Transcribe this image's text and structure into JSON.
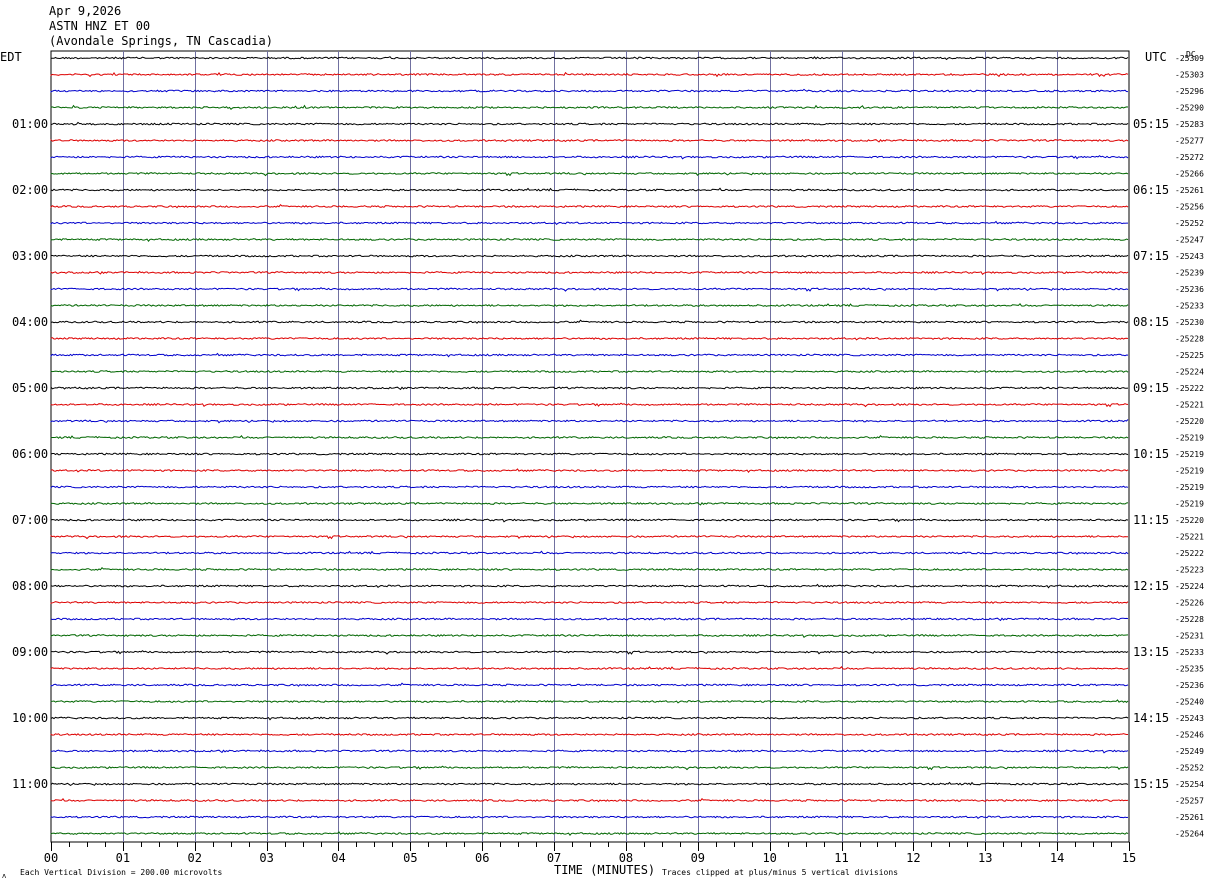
{
  "header": {
    "date": "Apr 9,2026",
    "station": "ASTN HNZ ET 00",
    "location": "(Avondale Springs, TN Cascadia)"
  },
  "labels": {
    "left_tz": "EDT",
    "right_tz": "UTC",
    "dc_label": "DC",
    "xlabel": "TIME (MINUTES)",
    "scale_note": "Each Vertical Division =  200.00 microvolts",
    "clip_note": "Traces clipped at plus/minus 5 vertical divisions",
    "corner_mark": "ʌ"
  },
  "colors": {
    "trace_cycle": [
      "#000000",
      "#dd0000",
      "#0000cc",
      "#006600"
    ],
    "gridline": "#7070a0",
    "text": "#000000"
  },
  "chart_data": {
    "type": "line",
    "description_kind": "helicorder",
    "xlim": [
      0,
      15
    ],
    "x_ticks": [
      "00",
      "01",
      "02",
      "03",
      "04",
      "05",
      "06",
      "07",
      "08",
      "09",
      "10",
      "11",
      "12",
      "13",
      "14",
      "15"
    ],
    "rows": 48,
    "left_time_labels": [
      "01:00",
      "02:00",
      "03:00",
      "04:00",
      "05:00",
      "06:00",
      "07:00",
      "08:00",
      "09:00",
      "10:00",
      "11:00"
    ],
    "right_time_labels": [
      "05:15",
      "06:15",
      "07:15",
      "08:15",
      "09:15",
      "10:15",
      "11:15",
      "12:15",
      "13:15",
      "14:15",
      "15:15"
    ],
    "dc_offsets": [
      "-25309",
      "-25303",
      "-25296",
      "-25290",
      "-25283",
      "-25277",
      "-25272",
      "-25266",
      "-25261",
      "-25256",
      "-25252",
      "-25247",
      "-25243",
      "-25239",
      "-25236",
      "-25233",
      "-25230",
      "-25228",
      "-25225",
      "-25224",
      "-25222",
      "-25221",
      "-25220",
      "-25219",
      "-25219",
      "-25219",
      "-25219",
      "-25219",
      "-25220",
      "-25221",
      "-25222",
      "-25223",
      "-25224",
      "-25226",
      "-25228",
      "-25231",
      "-25233",
      "-25235",
      "-25236",
      "-25240",
      "-25243",
      "-25246",
      "-25249",
      "-25252",
      "-25254",
      "-25257",
      "-25261",
      "-25264"
    ]
  }
}
